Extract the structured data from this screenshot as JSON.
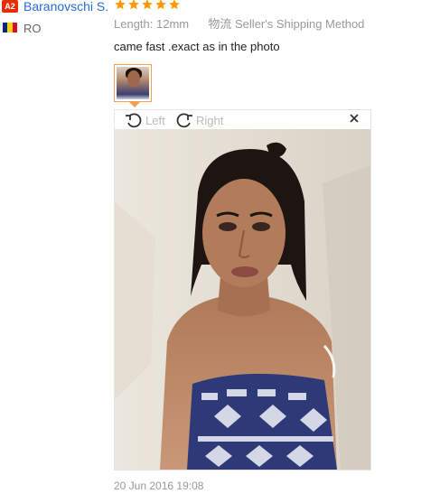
{
  "reviewer": {
    "level": "A2",
    "name": "Baranovschi S.",
    "country_code": "RO",
    "flag_colors": [
      "#002b7f",
      "#fcd116",
      "#ce1126"
    ]
  },
  "review": {
    "rating": 5,
    "rating_max": 5,
    "star_color": "#ff9900",
    "attributes": [
      {
        "name": "Length:",
        "value": "12mm"
      },
      {
        "name": "物流",
        "value": "Seller's Shipping Method"
      }
    ],
    "comment": "came fast .exact as in the photo",
    "date": "20 Jun 2016 19:08"
  },
  "viewer": {
    "rotate_left_label": "Left",
    "rotate_right_label": "Right",
    "close_icon": "close-icon",
    "accent_color": "#f0a050"
  }
}
